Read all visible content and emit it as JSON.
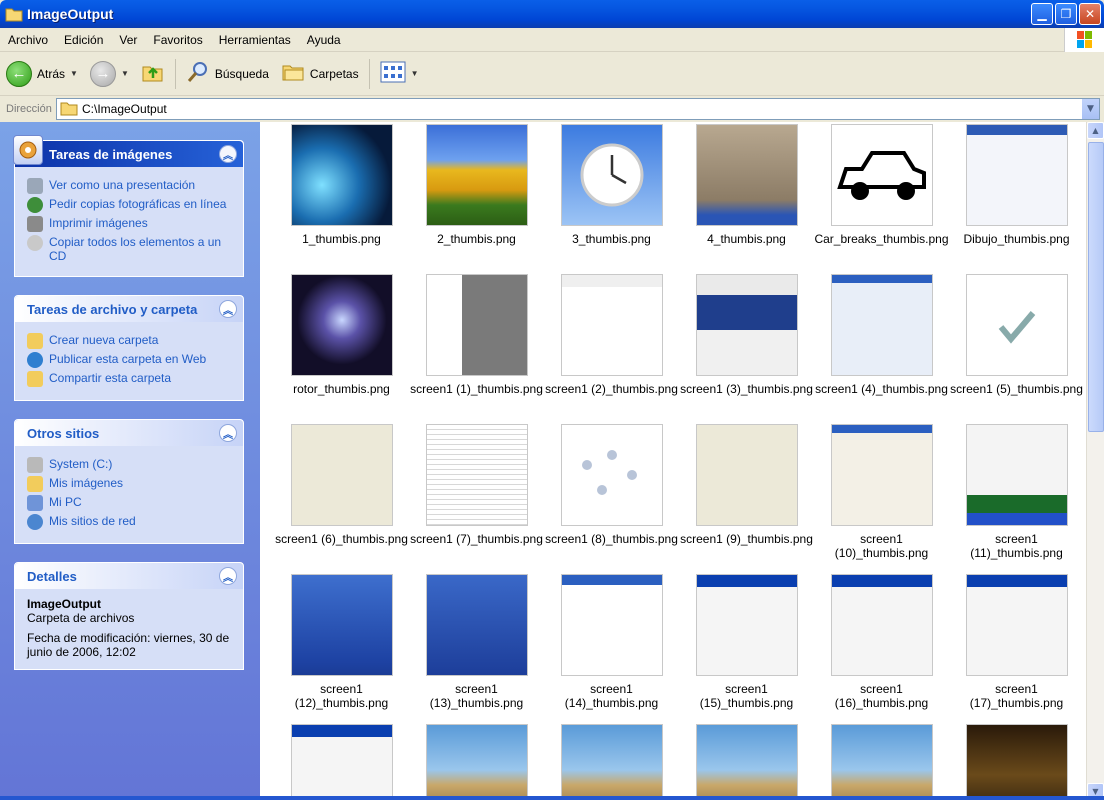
{
  "window": {
    "title": "ImageOutput"
  },
  "menu": [
    "Archivo",
    "Edición",
    "Ver",
    "Favoritos",
    "Herramientas",
    "Ayuda"
  ],
  "toolbar": {
    "back": "Atrás",
    "search": "Búsqueda",
    "folders": "Carpetas"
  },
  "address": {
    "label": "Dirección",
    "value": "C:\\ImageOutput"
  },
  "panels": {
    "image_tasks": {
      "title": "Tareas de imágenes",
      "items": [
        "Ver como una presentación",
        "Pedir copias fotográficas en línea",
        "Imprimir imágenes",
        "Copiar todos los elementos a un CD"
      ]
    },
    "file_tasks": {
      "title": "Tareas de archivo y carpeta",
      "items": [
        "Crear nueva carpeta",
        "Publicar esta carpeta en Web",
        "Compartir esta carpeta"
      ]
    },
    "other_places": {
      "title": "Otros sitios",
      "items": [
        "System (C:)",
        "Mis imágenes",
        "Mi PC",
        "Mis sitios de red"
      ]
    },
    "details": {
      "title": "Detalles",
      "name": "ImageOutput",
      "type": "Carpeta de archivos",
      "modified": "Fecha de modificación: viernes, 30 de junio de 2006, 12:02"
    }
  },
  "files": [
    "1_thumbis.png",
    "2_thumbis.png",
    "3_thumbis.png",
    "4_thumbis.png",
    "Car_breaks_thumbis.png",
    "Dibujo_thumbis.png",
    "rotor_thumbis.png",
    "screen1 (1)_thumbis.png",
    "screen1 (2)_thumbis.png",
    "screen1 (3)_thumbis.png",
    "screen1 (4)_thumbis.png",
    "screen1 (5)_thumbis.png",
    "screen1 (6)_thumbis.png",
    "screen1 (7)_thumbis.png",
    "screen1 (8)_thumbis.png",
    "screen1 (9)_thumbis.png",
    "screen1 (10)_thumbis.png",
    "screen1 (11)_thumbis.png",
    "screen1 (12)_thumbis.png",
    "screen1 (13)_thumbis.png",
    "screen1 (14)_thumbis.png",
    "screen1 (15)_thumbis.png",
    "screen1 (16)_thumbis.png",
    "screen1 (17)_thumbis.png",
    "",
    "",
    "",
    "",
    "",
    ""
  ],
  "thumb_styles": [
    "space",
    "tulips",
    "clock",
    "desert",
    "car",
    "webpage",
    "rotor",
    "appgray",
    "doc",
    "appblue",
    "appmulti",
    "check",
    "dialog",
    "textdoc",
    "diagram",
    "dialog2",
    "folders",
    "desktopgreen",
    "xpdesk",
    "xpdesk2",
    "winwhite",
    "installer",
    "installer2",
    "installer3",
    "installer",
    "game",
    "game",
    "game",
    "game",
    "gamedark"
  ]
}
